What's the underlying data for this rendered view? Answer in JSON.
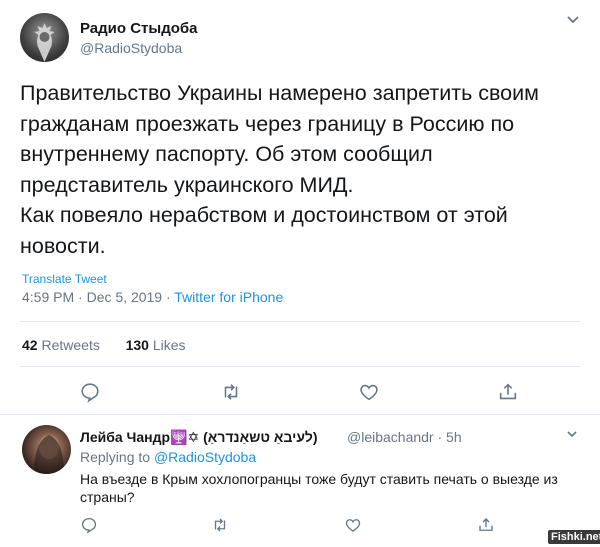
{
  "tweet": {
    "display_name": "Радио Стыдоба",
    "handle": "@RadioStydoba",
    "text": "Правительство Украины намерено запретить своим гражданам проезжать через границу в Россию по внутреннему паспорту. Об этом сообщил представитель украинского МИД.\nКак повеяло нерабством и достоинством от этой новости.",
    "translate_label": "Translate Tweet",
    "time": "4:59 PM",
    "date": "Dec 5, 2019",
    "source": "Twitter for iPhone",
    "retweets_count": "42",
    "retweets_label": "Retweets",
    "likes_count": "130",
    "likes_label": "Likes"
  },
  "reply": {
    "display_name": "Лейба Чандр🕎✡ (לעיבאַ טשאַנדראַ)",
    "handle_time": "@leibachandr · 5h",
    "replying_prefix": "Replying to",
    "replying_to": "@RadioStydoba",
    "text": "На въезде в Крым хохлопогранцы тоже будут ставить печать о выезде из страны?"
  },
  "watermark": "Fishki.net",
  "icons": [
    "reply-icon",
    "retweet-icon",
    "like-icon",
    "share-icon",
    "chevron-down-icon"
  ],
  "colors": {
    "link": "#1b95e0",
    "secondary": "#657786",
    "text": "#14171a",
    "divider": "#e1e8ed"
  }
}
